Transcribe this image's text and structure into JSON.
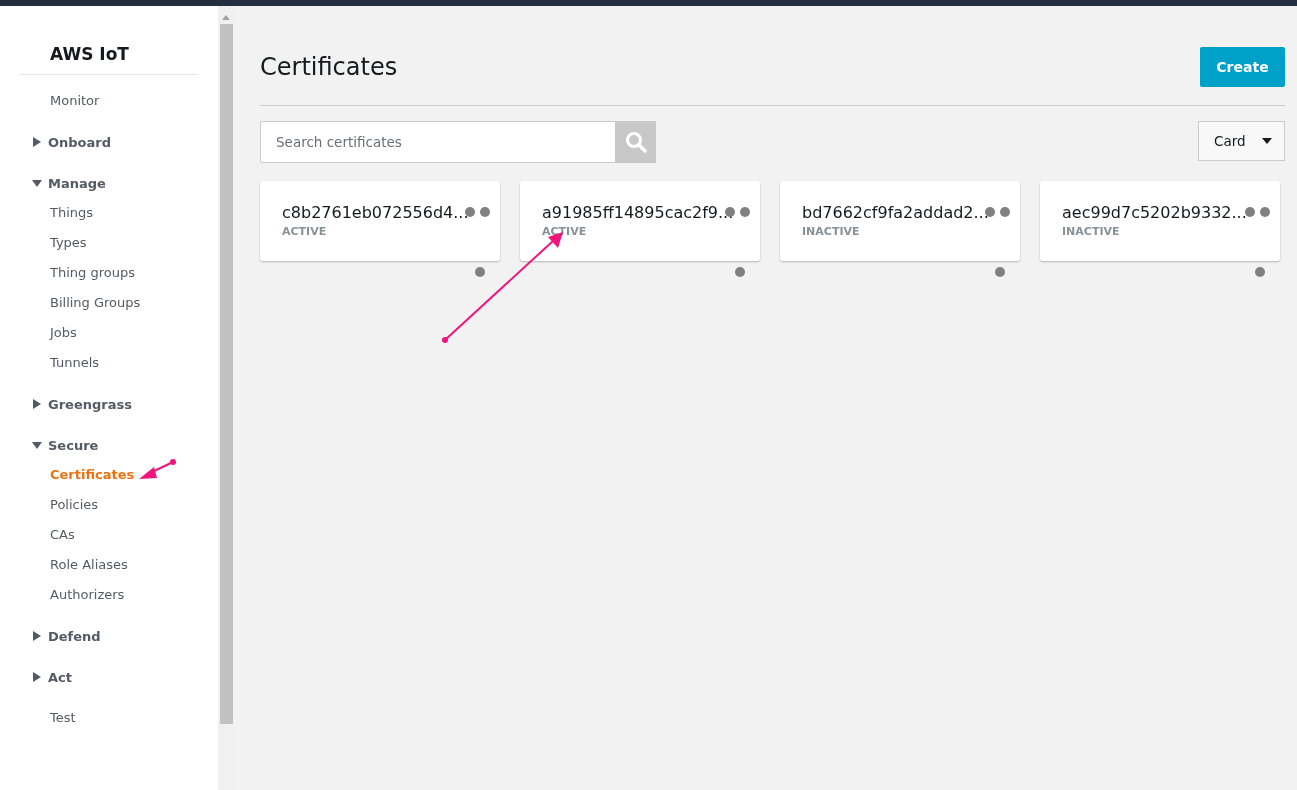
{
  "sidebar": {
    "title": "AWS IoT",
    "items": [
      {
        "kind": "link",
        "label": "Monitor",
        "selected": false
      },
      {
        "kind": "group",
        "label": "Onboard",
        "expanded": false
      },
      {
        "kind": "group",
        "label": "Manage",
        "expanded": true,
        "children": [
          {
            "label": "Things",
            "selected": false
          },
          {
            "label": "Types",
            "selected": false
          },
          {
            "label": "Thing groups",
            "selected": false
          },
          {
            "label": "Billing Groups",
            "selected": false
          },
          {
            "label": "Jobs",
            "selected": false
          },
          {
            "label": "Tunnels",
            "selected": false
          }
        ]
      },
      {
        "kind": "group",
        "label": "Greengrass",
        "expanded": false
      },
      {
        "kind": "group",
        "label": "Secure",
        "expanded": true,
        "children": [
          {
            "label": "Certificates",
            "selected": true
          },
          {
            "label": "Policies",
            "selected": false
          },
          {
            "label": "CAs",
            "selected": false
          },
          {
            "label": "Role Aliases",
            "selected": false
          },
          {
            "label": "Authorizers",
            "selected": false
          }
        ]
      },
      {
        "kind": "group",
        "label": "Defend",
        "expanded": false
      },
      {
        "kind": "group",
        "label": "Act",
        "expanded": false
      },
      {
        "kind": "link",
        "label": "Test",
        "selected": false
      }
    ]
  },
  "page": {
    "title": "Certificates",
    "create_button": "Create",
    "search": {
      "placeholder": "Search certificates"
    },
    "view_select": "Card"
  },
  "certificates": [
    {
      "id": "c8b2761eb072556d4...",
      "status": "ACTIVE"
    },
    {
      "id": "a91985ff14895cac2f9...",
      "status": "ACTIVE"
    },
    {
      "id": "bd7662cf9fa2addad2...",
      "status": "INACTIVE"
    },
    {
      "id": "aec99d7c5202b9332...",
      "status": "INACTIVE"
    }
  ]
}
